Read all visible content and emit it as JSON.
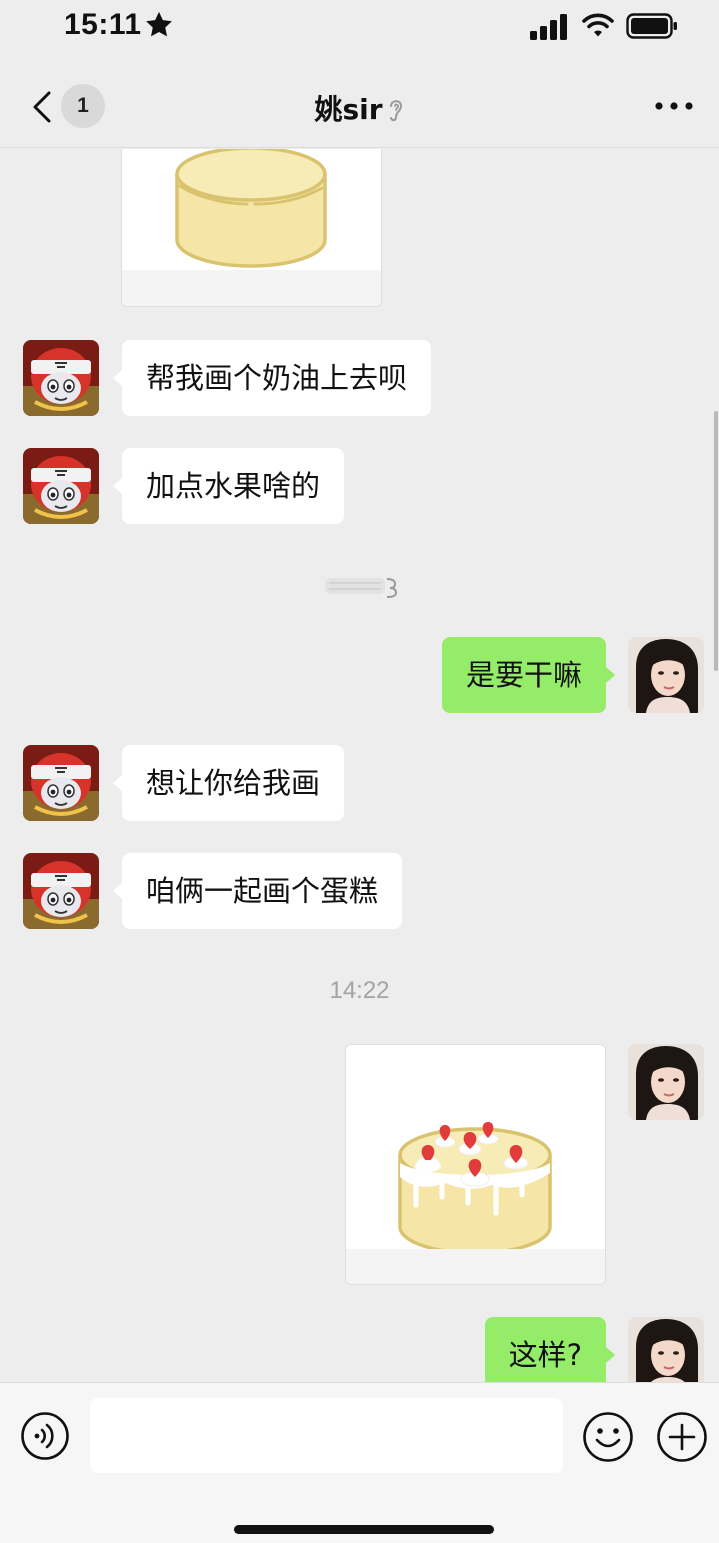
{
  "status_bar": {
    "time": "15:11",
    "icons": [
      "star-icon",
      "cellular-signal-icon",
      "wifi-icon",
      "battery-icon"
    ]
  },
  "nav": {
    "unread_count": "1",
    "title": "姚sir",
    "title_icon": "ear-icon",
    "left_icon": "chevron-left-icon",
    "right_icon": "more-dots-icon"
  },
  "messages": [
    {
      "type": "image",
      "side": "in",
      "image": "plain-cake-drawing"
    },
    {
      "type": "text",
      "side": "in",
      "text": "帮我画个奶油上去呗"
    },
    {
      "type": "text",
      "side": "in",
      "text": "加点水果啥的"
    },
    {
      "type": "recalled",
      "side": "center"
    },
    {
      "type": "text",
      "side": "out",
      "text": "是要干嘛"
    },
    {
      "type": "text",
      "side": "in",
      "text": "想让你给我画"
    },
    {
      "type": "text",
      "side": "in",
      "text": "咱俩一起画个蛋糕"
    },
    {
      "type": "time",
      "text": "14:22"
    },
    {
      "type": "image",
      "side": "out",
      "image": "cream-strawberry-cake-drawing"
    },
    {
      "type": "text",
      "side": "out",
      "text": "这样?"
    }
  ],
  "input_bar": {
    "placeholder": "",
    "icons": [
      "voice-icon",
      "emoji-icon",
      "plus-icon"
    ]
  },
  "colors": {
    "background": "#ededed",
    "outgoing_bubble": "#95ec69",
    "incoming_bubble": "#ffffff",
    "timestamp": "#a3a3a3",
    "cake_body": "#f5e6a8",
    "cake_outline": "#d9c36e",
    "strawberry": "#e23b3b"
  }
}
